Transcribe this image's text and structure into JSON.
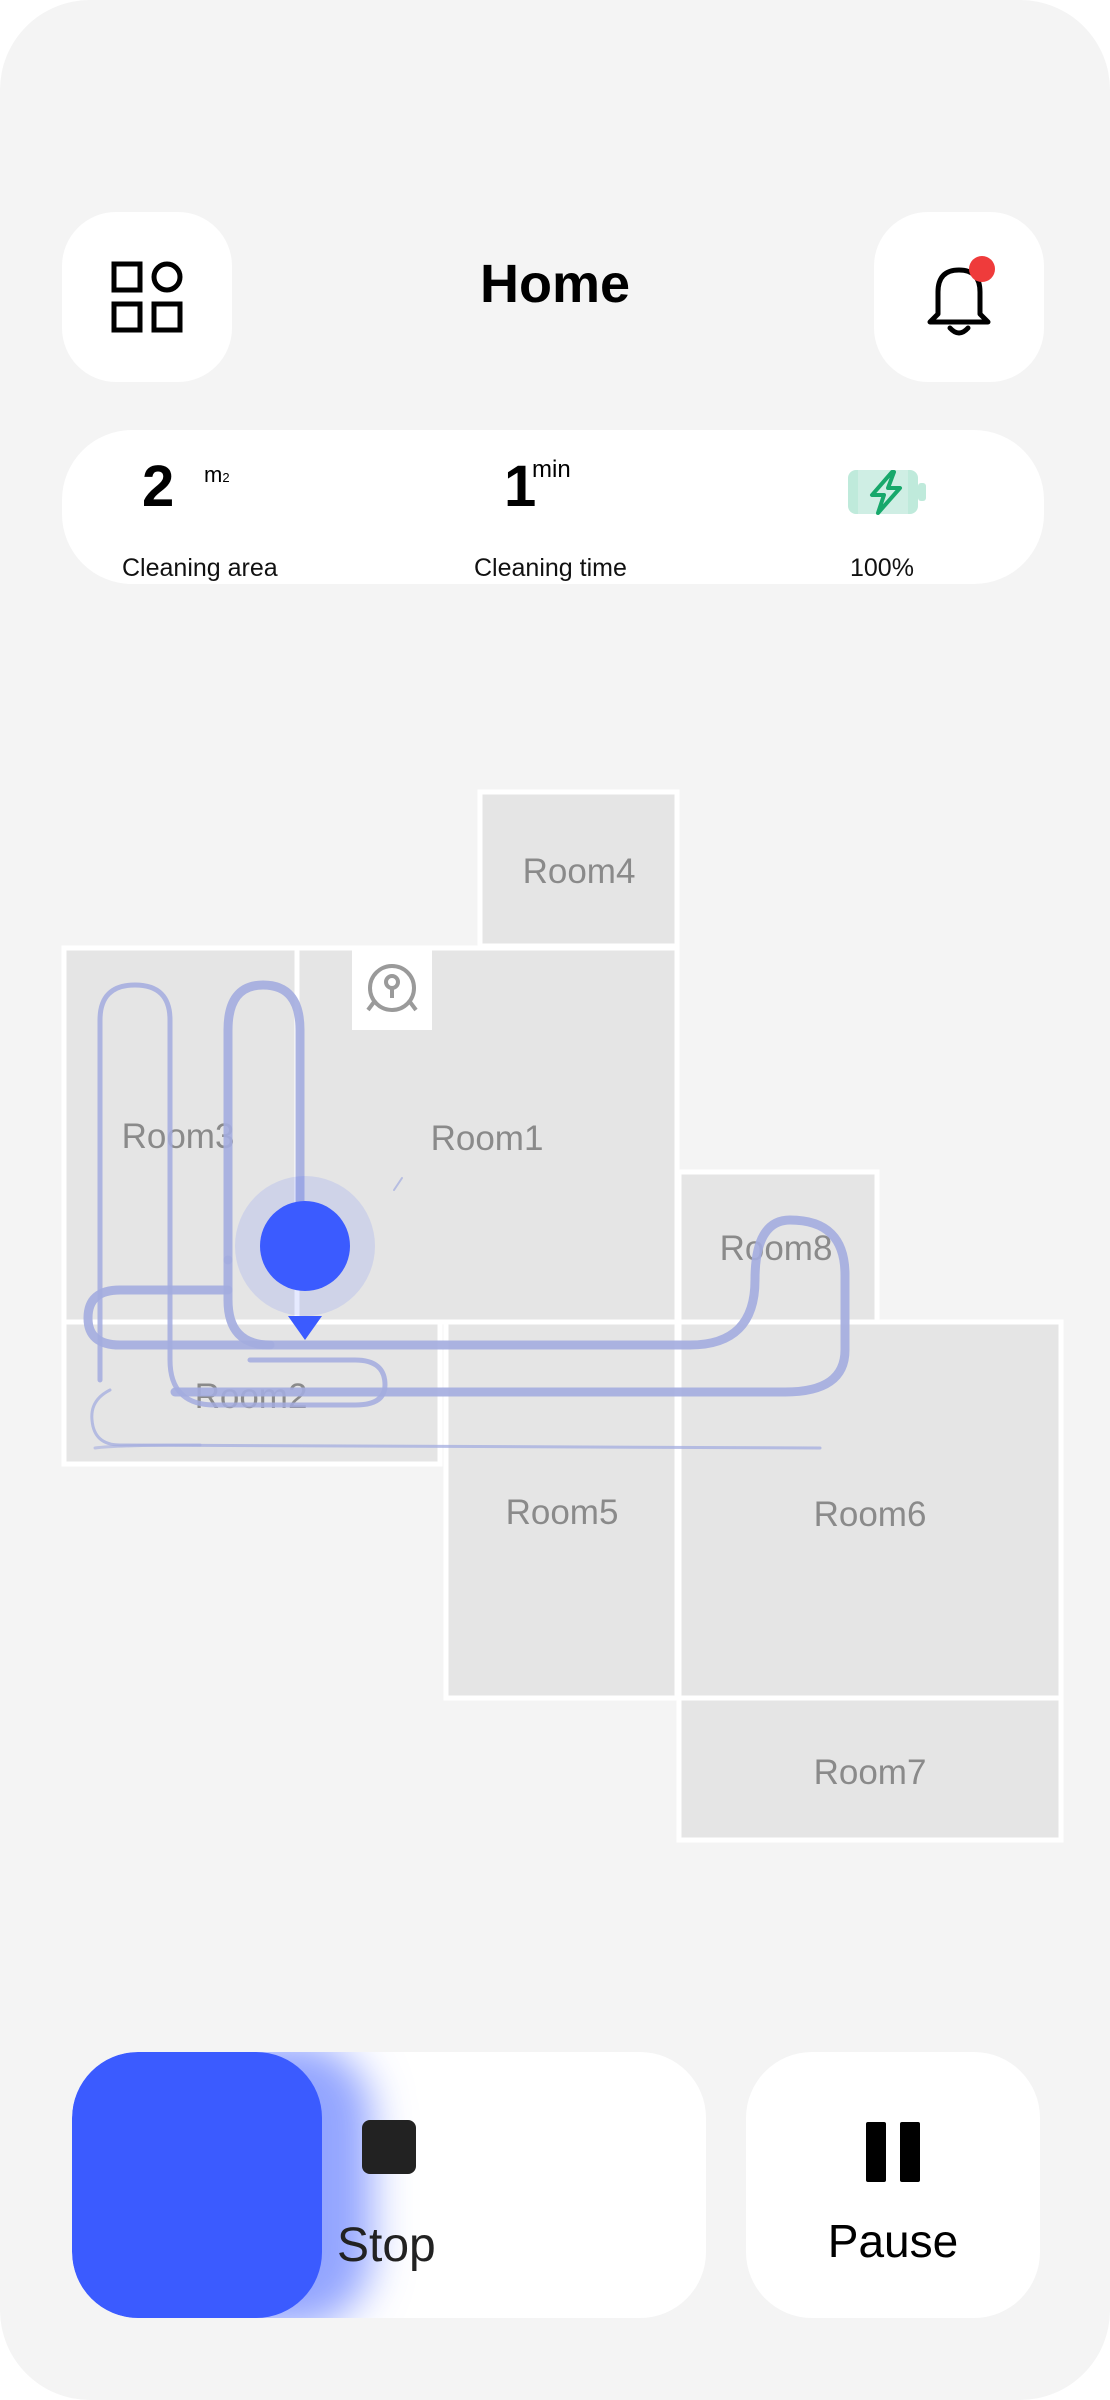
{
  "header": {
    "title": "Home",
    "menu_icon": "grid-icon",
    "notification_icon": "bell-icon",
    "notification_dot_color": "#ef3b3b"
  },
  "stats": {
    "area_value": "2",
    "area_unit": "m",
    "area_unit_sup": "2",
    "area_label": "Cleaning area",
    "time_value": "1",
    "time_unit": "min",
    "time_label": "Cleaning time",
    "battery_percent": "100%",
    "battery_icon": "battery-charging-icon",
    "battery_color": "#17a86b"
  },
  "map": {
    "rooms": [
      "Room1",
      "Room2",
      "Room3",
      "Room4",
      "Room5",
      "Room6",
      "Room7",
      "Room8"
    ],
    "path_color": "#a3acdf",
    "robot_color": "#3b5bff",
    "dock_icon": "charging-dock-icon"
  },
  "controls": {
    "stop_label": "Stop",
    "pause_label": "Pause",
    "accent_color": "#3b5bff"
  }
}
